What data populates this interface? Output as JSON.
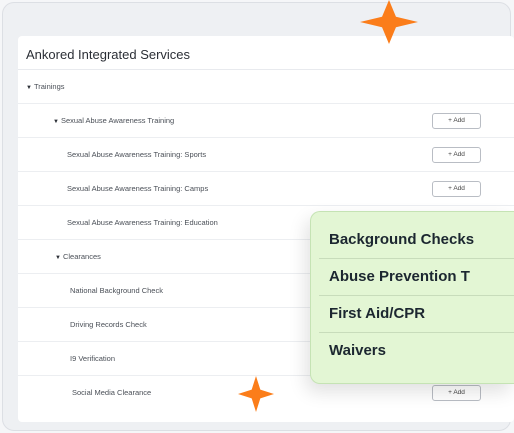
{
  "card": {
    "title": "Ankored Integrated Services"
  },
  "rows": [
    {
      "label": "Trainings",
      "caret": "▼",
      "add": ""
    },
    {
      "label": "Sexual Abuse Awareness Training",
      "caret": "▼",
      "add": "+ Add"
    },
    {
      "label": "Sexual Abuse Awareness Training: Sports",
      "caret": "",
      "add": "+ Add"
    },
    {
      "label": "Sexual Abuse Awareness Training: Camps",
      "caret": "",
      "add": "+ Add"
    },
    {
      "label": "Sexual Abuse Awareness Training: Education",
      "caret": "",
      "add": ""
    },
    {
      "label": "Clearances",
      "caret": "▼",
      "add": ""
    },
    {
      "label": "National Background Check",
      "caret": "",
      "add": ""
    },
    {
      "label": "Driving Records Check",
      "caret": "",
      "add": ""
    },
    {
      "label": "I9 Verification",
      "caret": "",
      "add": ""
    },
    {
      "label": "Social Media Clearance",
      "caret": "",
      "add": "+ Add"
    }
  ],
  "overlay": {
    "items": [
      "Background Checks",
      "Abuse Prevention T",
      "First Aid/CPR",
      "Waivers"
    ]
  },
  "colors": {
    "accent": "#fb7d1a",
    "overlay_bg": "#e3f6d4"
  },
  "icons": [
    "sparkle-icon",
    "caret-down-icon"
  ]
}
